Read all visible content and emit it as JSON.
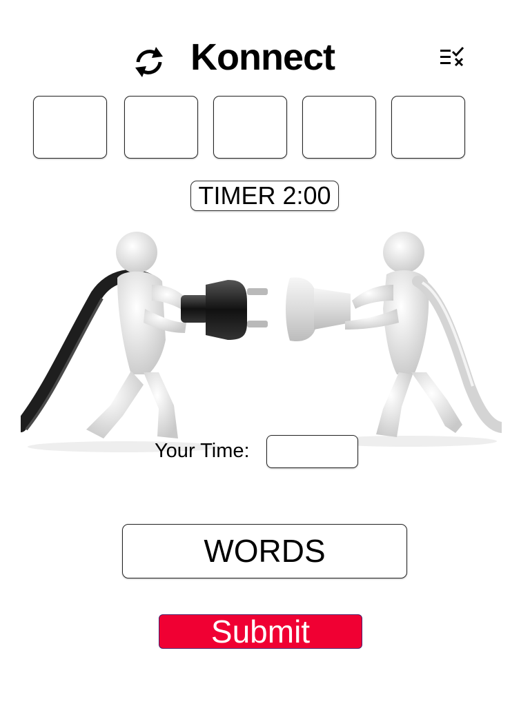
{
  "header": {
    "title": "Konnect",
    "refresh_icon": "refresh-icon",
    "menu_icon": "checklist-clear-icon"
  },
  "slots": [
    "",
    "",
    "",
    "",
    ""
  ],
  "timer": {
    "label": "TIMER 2:00"
  },
  "illustration": {
    "subject": "two figures pulling apart an electrical plug and socket"
  },
  "your_time": {
    "label": "Your Time:",
    "value": ""
  },
  "words": {
    "label": "WORDS"
  },
  "submit": {
    "label": "Submit"
  },
  "colors": {
    "submit_bg": "#f00033",
    "submit_text": "#ffffff",
    "text": "#000000",
    "border": "#222222"
  }
}
